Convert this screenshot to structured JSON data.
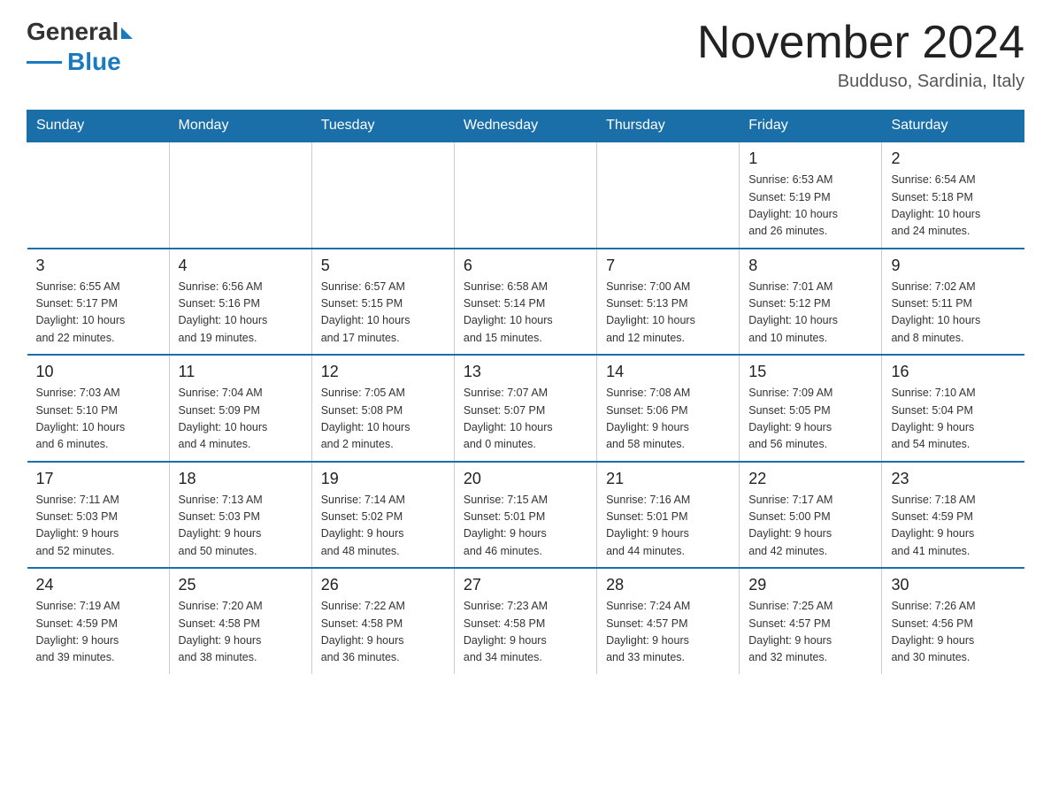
{
  "header": {
    "logo": {
      "general": "General",
      "blue": "Blue"
    },
    "title": "November 2024",
    "location": "Budduso, Sardinia, Italy"
  },
  "weekdays": [
    "Sunday",
    "Monday",
    "Tuesday",
    "Wednesday",
    "Thursday",
    "Friday",
    "Saturday"
  ],
  "weeks": [
    [
      {
        "day": "",
        "info": ""
      },
      {
        "day": "",
        "info": ""
      },
      {
        "day": "",
        "info": ""
      },
      {
        "day": "",
        "info": ""
      },
      {
        "day": "",
        "info": ""
      },
      {
        "day": "1",
        "info": "Sunrise: 6:53 AM\nSunset: 5:19 PM\nDaylight: 10 hours\nand 26 minutes."
      },
      {
        "day": "2",
        "info": "Sunrise: 6:54 AM\nSunset: 5:18 PM\nDaylight: 10 hours\nand 24 minutes."
      }
    ],
    [
      {
        "day": "3",
        "info": "Sunrise: 6:55 AM\nSunset: 5:17 PM\nDaylight: 10 hours\nand 22 minutes."
      },
      {
        "day": "4",
        "info": "Sunrise: 6:56 AM\nSunset: 5:16 PM\nDaylight: 10 hours\nand 19 minutes."
      },
      {
        "day": "5",
        "info": "Sunrise: 6:57 AM\nSunset: 5:15 PM\nDaylight: 10 hours\nand 17 minutes."
      },
      {
        "day": "6",
        "info": "Sunrise: 6:58 AM\nSunset: 5:14 PM\nDaylight: 10 hours\nand 15 minutes."
      },
      {
        "day": "7",
        "info": "Sunrise: 7:00 AM\nSunset: 5:13 PM\nDaylight: 10 hours\nand 12 minutes."
      },
      {
        "day": "8",
        "info": "Sunrise: 7:01 AM\nSunset: 5:12 PM\nDaylight: 10 hours\nand 10 minutes."
      },
      {
        "day": "9",
        "info": "Sunrise: 7:02 AM\nSunset: 5:11 PM\nDaylight: 10 hours\nand 8 minutes."
      }
    ],
    [
      {
        "day": "10",
        "info": "Sunrise: 7:03 AM\nSunset: 5:10 PM\nDaylight: 10 hours\nand 6 minutes."
      },
      {
        "day": "11",
        "info": "Sunrise: 7:04 AM\nSunset: 5:09 PM\nDaylight: 10 hours\nand 4 minutes."
      },
      {
        "day": "12",
        "info": "Sunrise: 7:05 AM\nSunset: 5:08 PM\nDaylight: 10 hours\nand 2 minutes."
      },
      {
        "day": "13",
        "info": "Sunrise: 7:07 AM\nSunset: 5:07 PM\nDaylight: 10 hours\nand 0 minutes."
      },
      {
        "day": "14",
        "info": "Sunrise: 7:08 AM\nSunset: 5:06 PM\nDaylight: 9 hours\nand 58 minutes."
      },
      {
        "day": "15",
        "info": "Sunrise: 7:09 AM\nSunset: 5:05 PM\nDaylight: 9 hours\nand 56 minutes."
      },
      {
        "day": "16",
        "info": "Sunrise: 7:10 AM\nSunset: 5:04 PM\nDaylight: 9 hours\nand 54 minutes."
      }
    ],
    [
      {
        "day": "17",
        "info": "Sunrise: 7:11 AM\nSunset: 5:03 PM\nDaylight: 9 hours\nand 52 minutes."
      },
      {
        "day": "18",
        "info": "Sunrise: 7:13 AM\nSunset: 5:03 PM\nDaylight: 9 hours\nand 50 minutes."
      },
      {
        "day": "19",
        "info": "Sunrise: 7:14 AM\nSunset: 5:02 PM\nDaylight: 9 hours\nand 48 minutes."
      },
      {
        "day": "20",
        "info": "Sunrise: 7:15 AM\nSunset: 5:01 PM\nDaylight: 9 hours\nand 46 minutes."
      },
      {
        "day": "21",
        "info": "Sunrise: 7:16 AM\nSunset: 5:01 PM\nDaylight: 9 hours\nand 44 minutes."
      },
      {
        "day": "22",
        "info": "Sunrise: 7:17 AM\nSunset: 5:00 PM\nDaylight: 9 hours\nand 42 minutes."
      },
      {
        "day": "23",
        "info": "Sunrise: 7:18 AM\nSunset: 4:59 PM\nDaylight: 9 hours\nand 41 minutes."
      }
    ],
    [
      {
        "day": "24",
        "info": "Sunrise: 7:19 AM\nSunset: 4:59 PM\nDaylight: 9 hours\nand 39 minutes."
      },
      {
        "day": "25",
        "info": "Sunrise: 7:20 AM\nSunset: 4:58 PM\nDaylight: 9 hours\nand 38 minutes."
      },
      {
        "day": "26",
        "info": "Sunrise: 7:22 AM\nSunset: 4:58 PM\nDaylight: 9 hours\nand 36 minutes."
      },
      {
        "day": "27",
        "info": "Sunrise: 7:23 AM\nSunset: 4:58 PM\nDaylight: 9 hours\nand 34 minutes."
      },
      {
        "day": "28",
        "info": "Sunrise: 7:24 AM\nSunset: 4:57 PM\nDaylight: 9 hours\nand 33 minutes."
      },
      {
        "day": "29",
        "info": "Sunrise: 7:25 AM\nSunset: 4:57 PM\nDaylight: 9 hours\nand 32 minutes."
      },
      {
        "day": "30",
        "info": "Sunrise: 7:26 AM\nSunset: 4:56 PM\nDaylight: 9 hours\nand 30 minutes."
      }
    ]
  ]
}
